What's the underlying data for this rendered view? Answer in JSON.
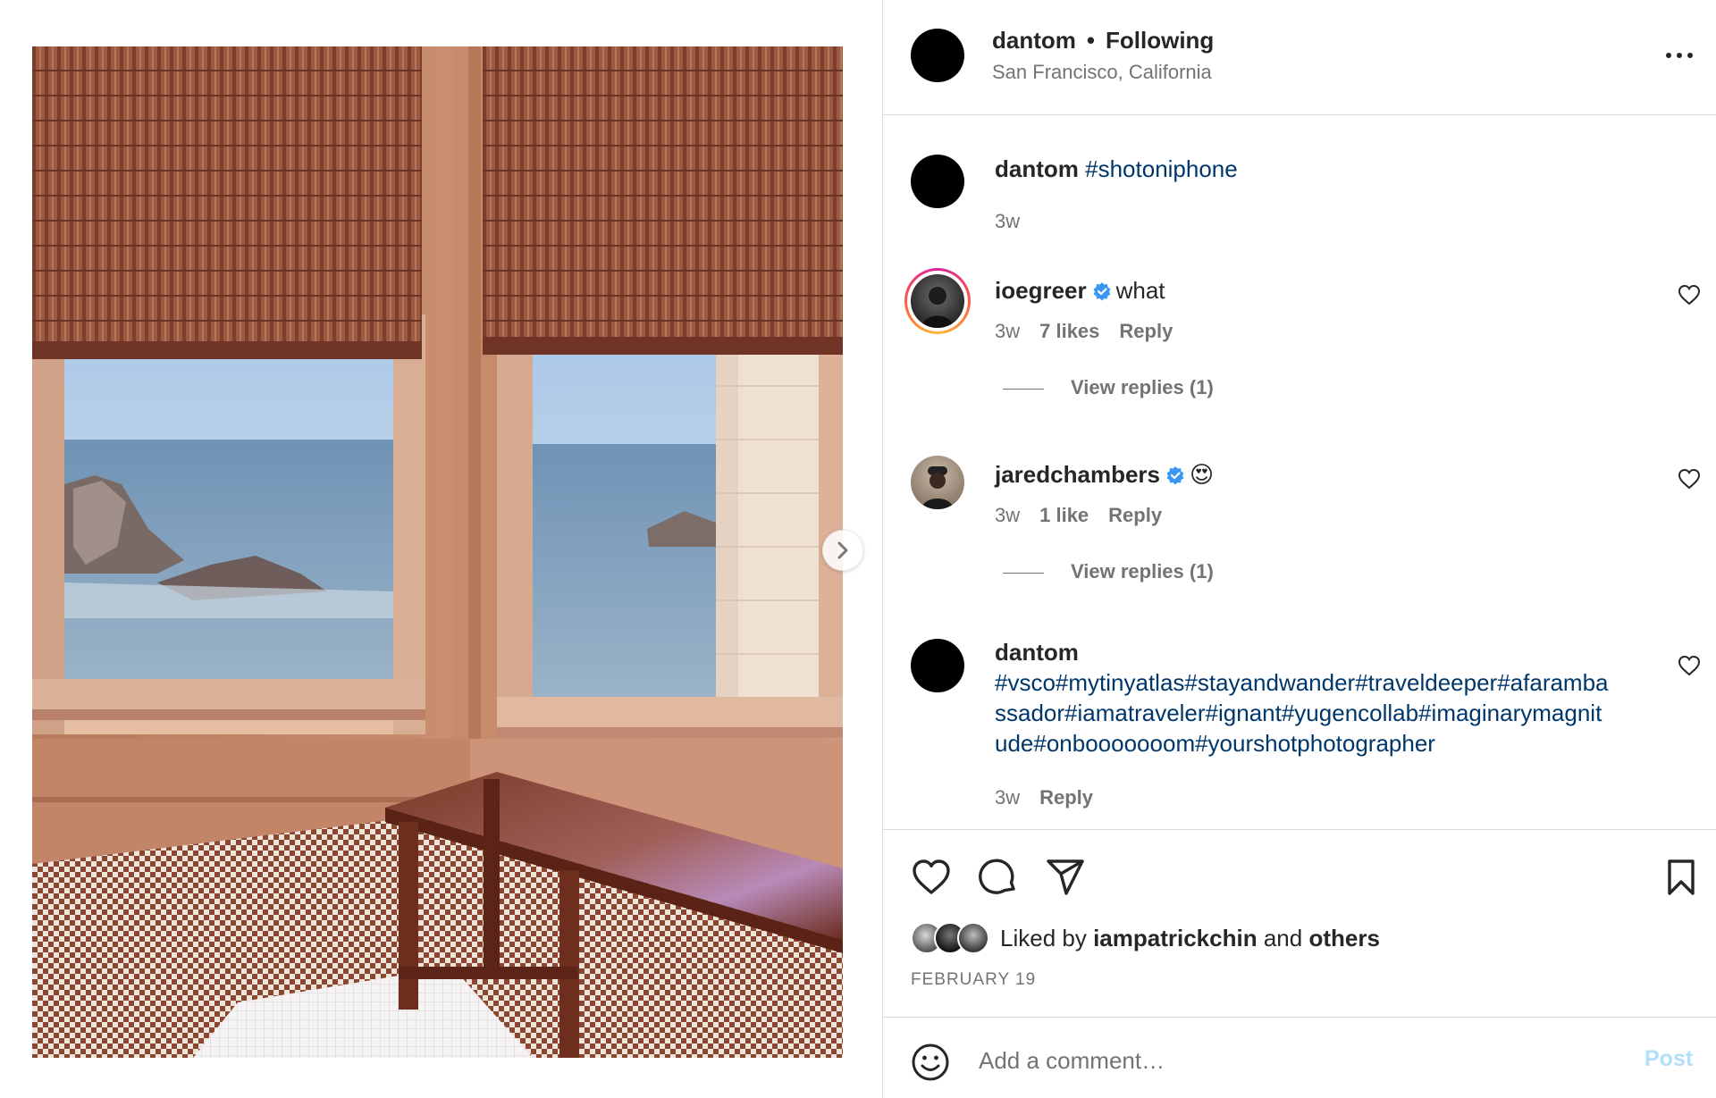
{
  "post": {
    "username": "dantom",
    "separator": "•",
    "follow_status": "Following",
    "location": "San Francisco, California"
  },
  "caption": {
    "username": "dantom",
    "text": "#shotoniphone",
    "time": "3w"
  },
  "comments": [
    {
      "username": "ioegreer",
      "verified": true,
      "text": "what",
      "time": "3w",
      "likes": "7 likes",
      "reply_label": "Reply",
      "view_replies": "View replies (1)"
    },
    {
      "username": "jaredchambers",
      "verified": true,
      "text": "😍",
      "time": "3w",
      "likes": "1 like",
      "reply_label": "Reply",
      "view_replies": "View replies (1)"
    },
    {
      "username": "dantom",
      "verified": false,
      "text": "#vsco#mytinyatlas#stayandwander#traveldeeper#afaramba ssador#iamatraveler#ignant#yugencollab#imaginarymagnit ude#onbooooooom#yourshotphotographer",
      "text_lines": [
        "#vsco#mytinyatlas#stayandwander#traveldeeper#afaramba",
        "ssador#iamatraveler#ignant#yugencollab#imaginarymagnit",
        "ude#onbooooooom#yourshotphotographer"
      ],
      "time": "3w",
      "reply_label": "Reply"
    }
  ],
  "likes": {
    "prefix": "Liked by",
    "user": "iampatrickchin",
    "and": "and",
    "others": "others"
  },
  "date": "FEBRUARY 19",
  "add_comment": {
    "placeholder": "Add a comment…",
    "post_label": "Post"
  },
  "icons": {
    "more": "more-options-icon",
    "next": "chevron-right-icon",
    "like": "heart-icon",
    "comment": "comment-bubble-icon",
    "share": "paper-plane-icon",
    "save": "bookmark-icon",
    "emoji": "emoji-smiley-icon",
    "verified": "verified-badge-icon"
  },
  "colors": {
    "hashtag": "#00376b",
    "verified": "#3897f0",
    "muted": "#737373",
    "post_disabled": "#b2dffc"
  }
}
